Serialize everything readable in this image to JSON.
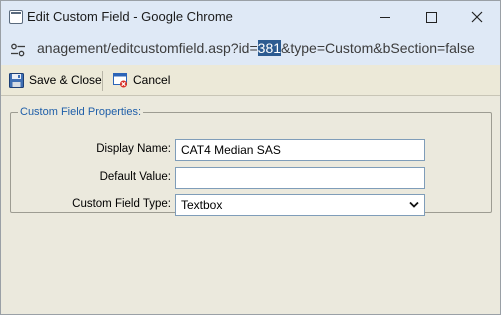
{
  "window": {
    "title": "Edit Custom Field - Google Chrome"
  },
  "address_bar": {
    "url_before": "anagement/editcustomfield.asp?id=",
    "url_selected": "381",
    "url_after": "&type=Custom&bSection=false"
  },
  "toolbar": {
    "save_label": "Save & Close",
    "cancel_label": "Cancel"
  },
  "form": {
    "legend": "Custom Field Properties:",
    "display_name_label": "Display Name:",
    "display_name_value": "CAT4 Median SAS",
    "default_value_label": "Default Value:",
    "default_value_value": "",
    "field_type_label": "Custom Field Type:",
    "field_type_value": "Textbox"
  },
  "colors": {
    "legend": "#1f5fa9",
    "selection": "#2c5b91",
    "titlebar": "#dfe9f6",
    "content_bg": "#ebe9dd"
  }
}
